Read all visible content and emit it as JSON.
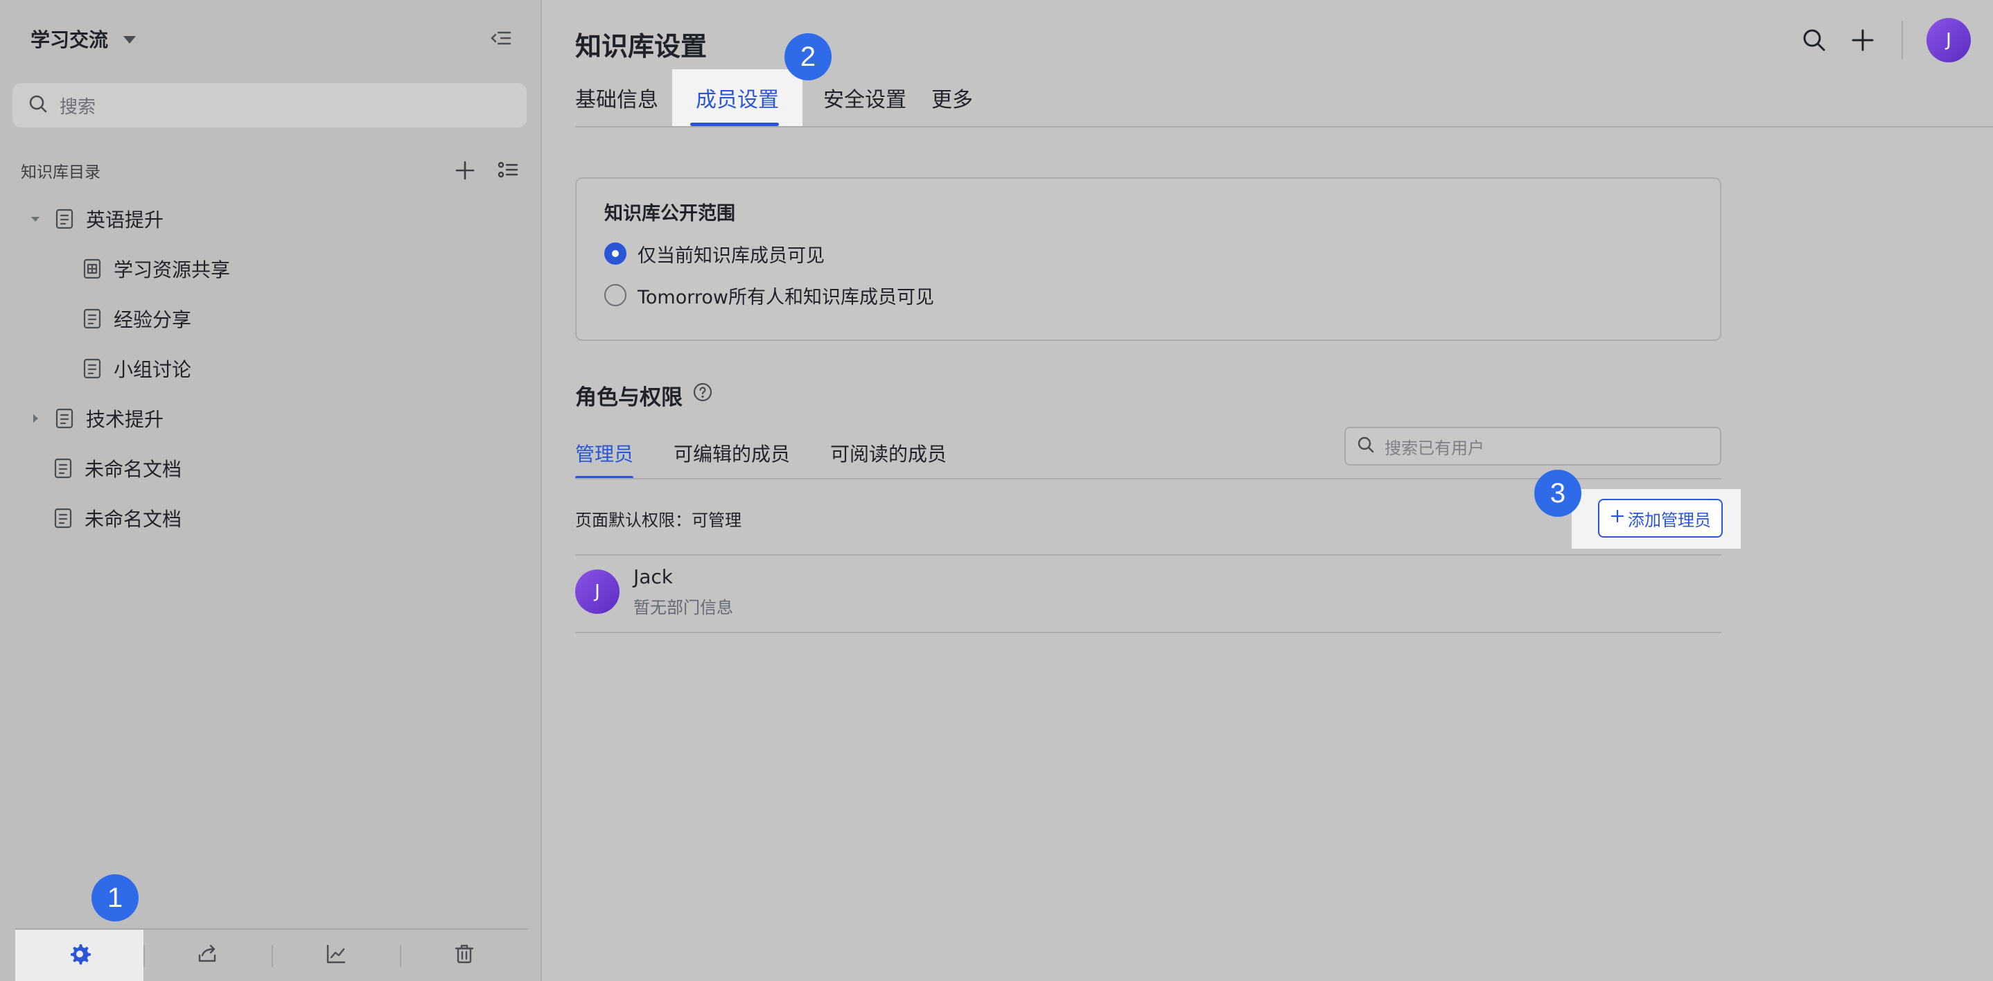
{
  "workspace": {
    "title": "学习交流"
  },
  "sidebar": {
    "search_placeholder": "搜索",
    "section_label": "知识库目录",
    "tree": [
      {
        "label": "英语提升"
      },
      {
        "label": "学习资源共享"
      },
      {
        "label": "经验分享"
      },
      {
        "label": "小组讨论"
      },
      {
        "label": "技术提升"
      },
      {
        "label": "未命名文档"
      },
      {
        "label": "未命名文档"
      }
    ],
    "bottom_tools": [
      "gear-icon",
      "share-icon",
      "chart-icon",
      "trash-icon"
    ]
  },
  "header": {
    "title": "知识库设置",
    "avatar_initial": "J"
  },
  "tabs": [
    {
      "label": "基础信息"
    },
    {
      "label": "成员设置"
    },
    {
      "label": "安全设置"
    },
    {
      "label": "更多"
    }
  ],
  "visibility": {
    "title": "知识库公开范围",
    "options": [
      {
        "label": "仅当前知识库成员可见",
        "selected": true
      },
      {
        "label": "Tomorrow所有人和知识库成员可见",
        "selected": false
      }
    ]
  },
  "roles": {
    "title": "角色与权限",
    "tabs": [
      {
        "label": "管理员"
      },
      {
        "label": "可编辑的成员"
      },
      {
        "label": "可阅读的成员"
      }
    ],
    "search_placeholder": "搜索已有用户",
    "default_permission": "页面默认权限：可管理",
    "add_button": "添加管理员",
    "members": [
      {
        "initial": "J",
        "name": "Jack",
        "dept": "暂无部门信息"
      }
    ]
  },
  "steps": [
    "1",
    "2",
    "3"
  ],
  "colors": {
    "accent": "#2a55d6",
    "step": "#2f6ae8",
    "avatar": "#6f3fd6"
  }
}
